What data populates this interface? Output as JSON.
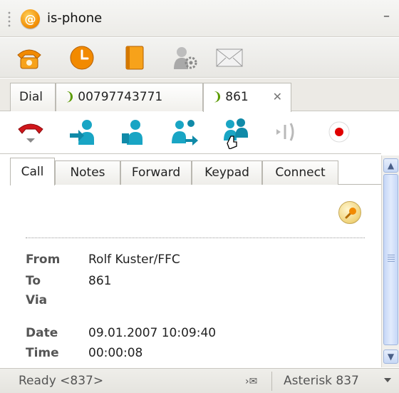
{
  "window": {
    "title": "is-phone",
    "minimize_glyph": "–"
  },
  "toolbar": [
    {
      "icon": "phone-icon"
    },
    {
      "icon": "clock-icon"
    },
    {
      "icon": "phonebook-icon"
    },
    {
      "icon": "user-settings-icon"
    },
    {
      "icon": "envelope-icon"
    }
  ],
  "call_tabs": [
    {
      "label": "Dial"
    },
    {
      "label": "00797743771",
      "phone_glyph": "❩"
    },
    {
      "label": "861",
      "phone_glyph": "❩",
      "close_glyph": "✕",
      "active": true
    }
  ],
  "call_actions": [
    {
      "icon": "hangup-icon"
    },
    {
      "icon": "transfer-icon"
    },
    {
      "icon": "hold-icon"
    },
    {
      "icon": "forward-user-icon"
    },
    {
      "icon": "conference-icon"
    },
    {
      "icon": "park-icon"
    },
    {
      "icon": "record-icon"
    }
  ],
  "detail_tabs": [
    "Call",
    "Notes",
    "Forward",
    "Keypad",
    "Connect"
  ],
  "active_detail_tab": "Call",
  "call_info": {
    "from_label": "From",
    "from_value": "Rolf Kuster/FFC",
    "to_label": "To",
    "to_value": "861",
    "via_label": "Via",
    "via_value": "",
    "date_label": "Date",
    "date_value": "09.01.2007 10:09:40",
    "time_label": "Time",
    "time_value": "00:00:08"
  },
  "scroll_arrows": {
    "up": "▲",
    "down": "▼"
  },
  "status": {
    "text": "Ready <837>",
    "mail_glyph": "›✉",
    "server": "Asterisk 837"
  },
  "colors": {
    "accent_teal": "#19a5c4",
    "hangup_red": "#d0161b",
    "record_red": "#e00000",
    "phone_green": "#5a9a00",
    "toolbar_orange": "#f28a00"
  }
}
